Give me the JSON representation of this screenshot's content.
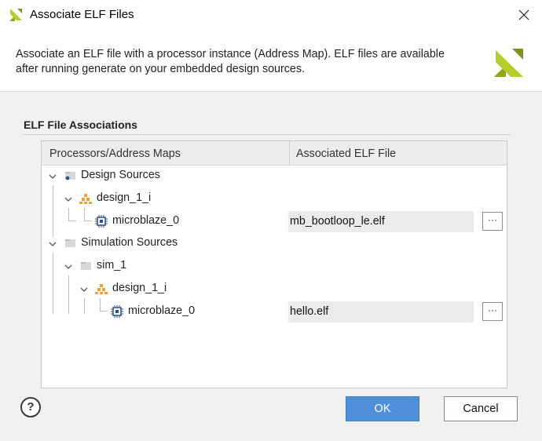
{
  "window": {
    "title": "Associate ELF Files",
    "logo_icon": "xilinx-logo-icon",
    "close_icon": "close-icon"
  },
  "header": {
    "description_line1": "Associate an ELF file with a processor instance (Address Map). ELF files are available",
    "description_line2": "after running generate on your embedded design sources."
  },
  "section": {
    "title": "ELF File Associations"
  },
  "table": {
    "columns": [
      "Processors/Address Maps",
      "Associated ELF File"
    ],
    "tree": {
      "design_sources": "Design Sources",
      "design_1_i_a": "design_1_i",
      "microblaze_a": "microblaze_0",
      "microblaze_a_elf": "mb_bootloop_le.elf",
      "simulation_sources": "Simulation Sources",
      "sim_1": "sim_1",
      "design_1_i_b": "design_1_i",
      "microblaze_b": "microblaze_0",
      "microblaze_b_elf": "hello.elf"
    },
    "browse_label": "···"
  },
  "footer": {
    "help_label": "?",
    "ok_label": "OK",
    "cancel_label": "Cancel"
  },
  "colors": {
    "accent": "#4e8fd8",
    "xilinx_green": "#a4bd1b",
    "hierarchy_orange": "#f0a030",
    "processor_blue": "#2b4f8f"
  }
}
